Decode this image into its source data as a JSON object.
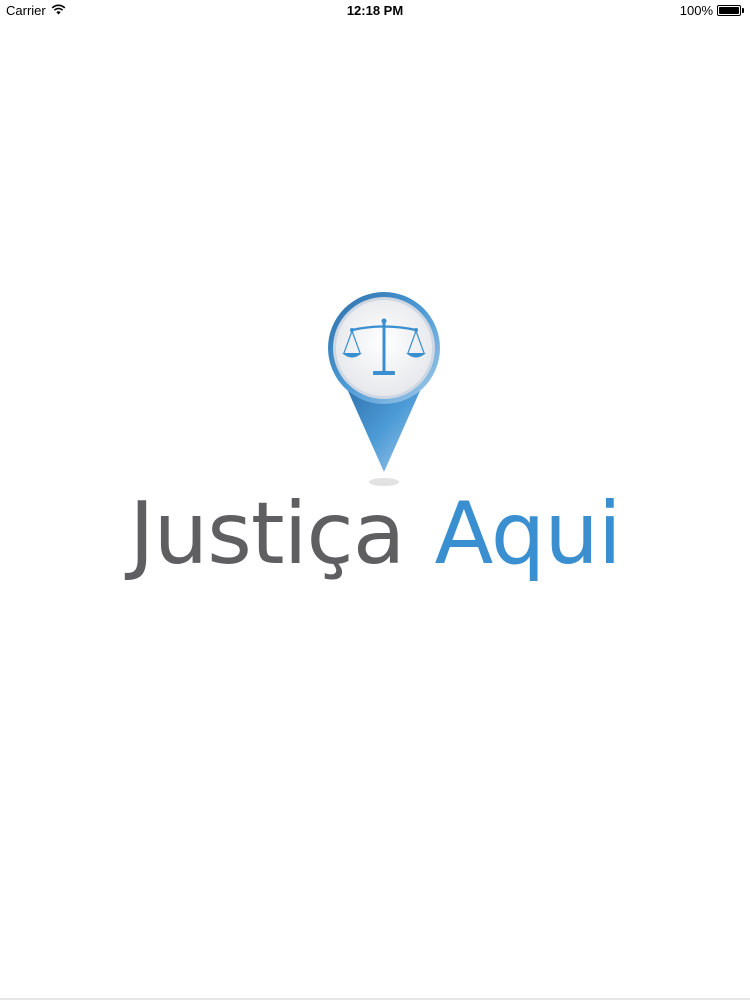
{
  "status_bar": {
    "carrier": "Carrier",
    "wifi_icon": "wifi-icon",
    "time": "12:18 PM",
    "battery_text": "100%",
    "battery_level": 1.0
  },
  "logo": {
    "icon": "scales-of-justice-pin-icon",
    "word_first": "Justiça",
    "word_second": "Aqui",
    "colors": {
      "first": "#5f5f61",
      "second": "#3a8fd0",
      "pin": "#3a8fd0"
    }
  }
}
